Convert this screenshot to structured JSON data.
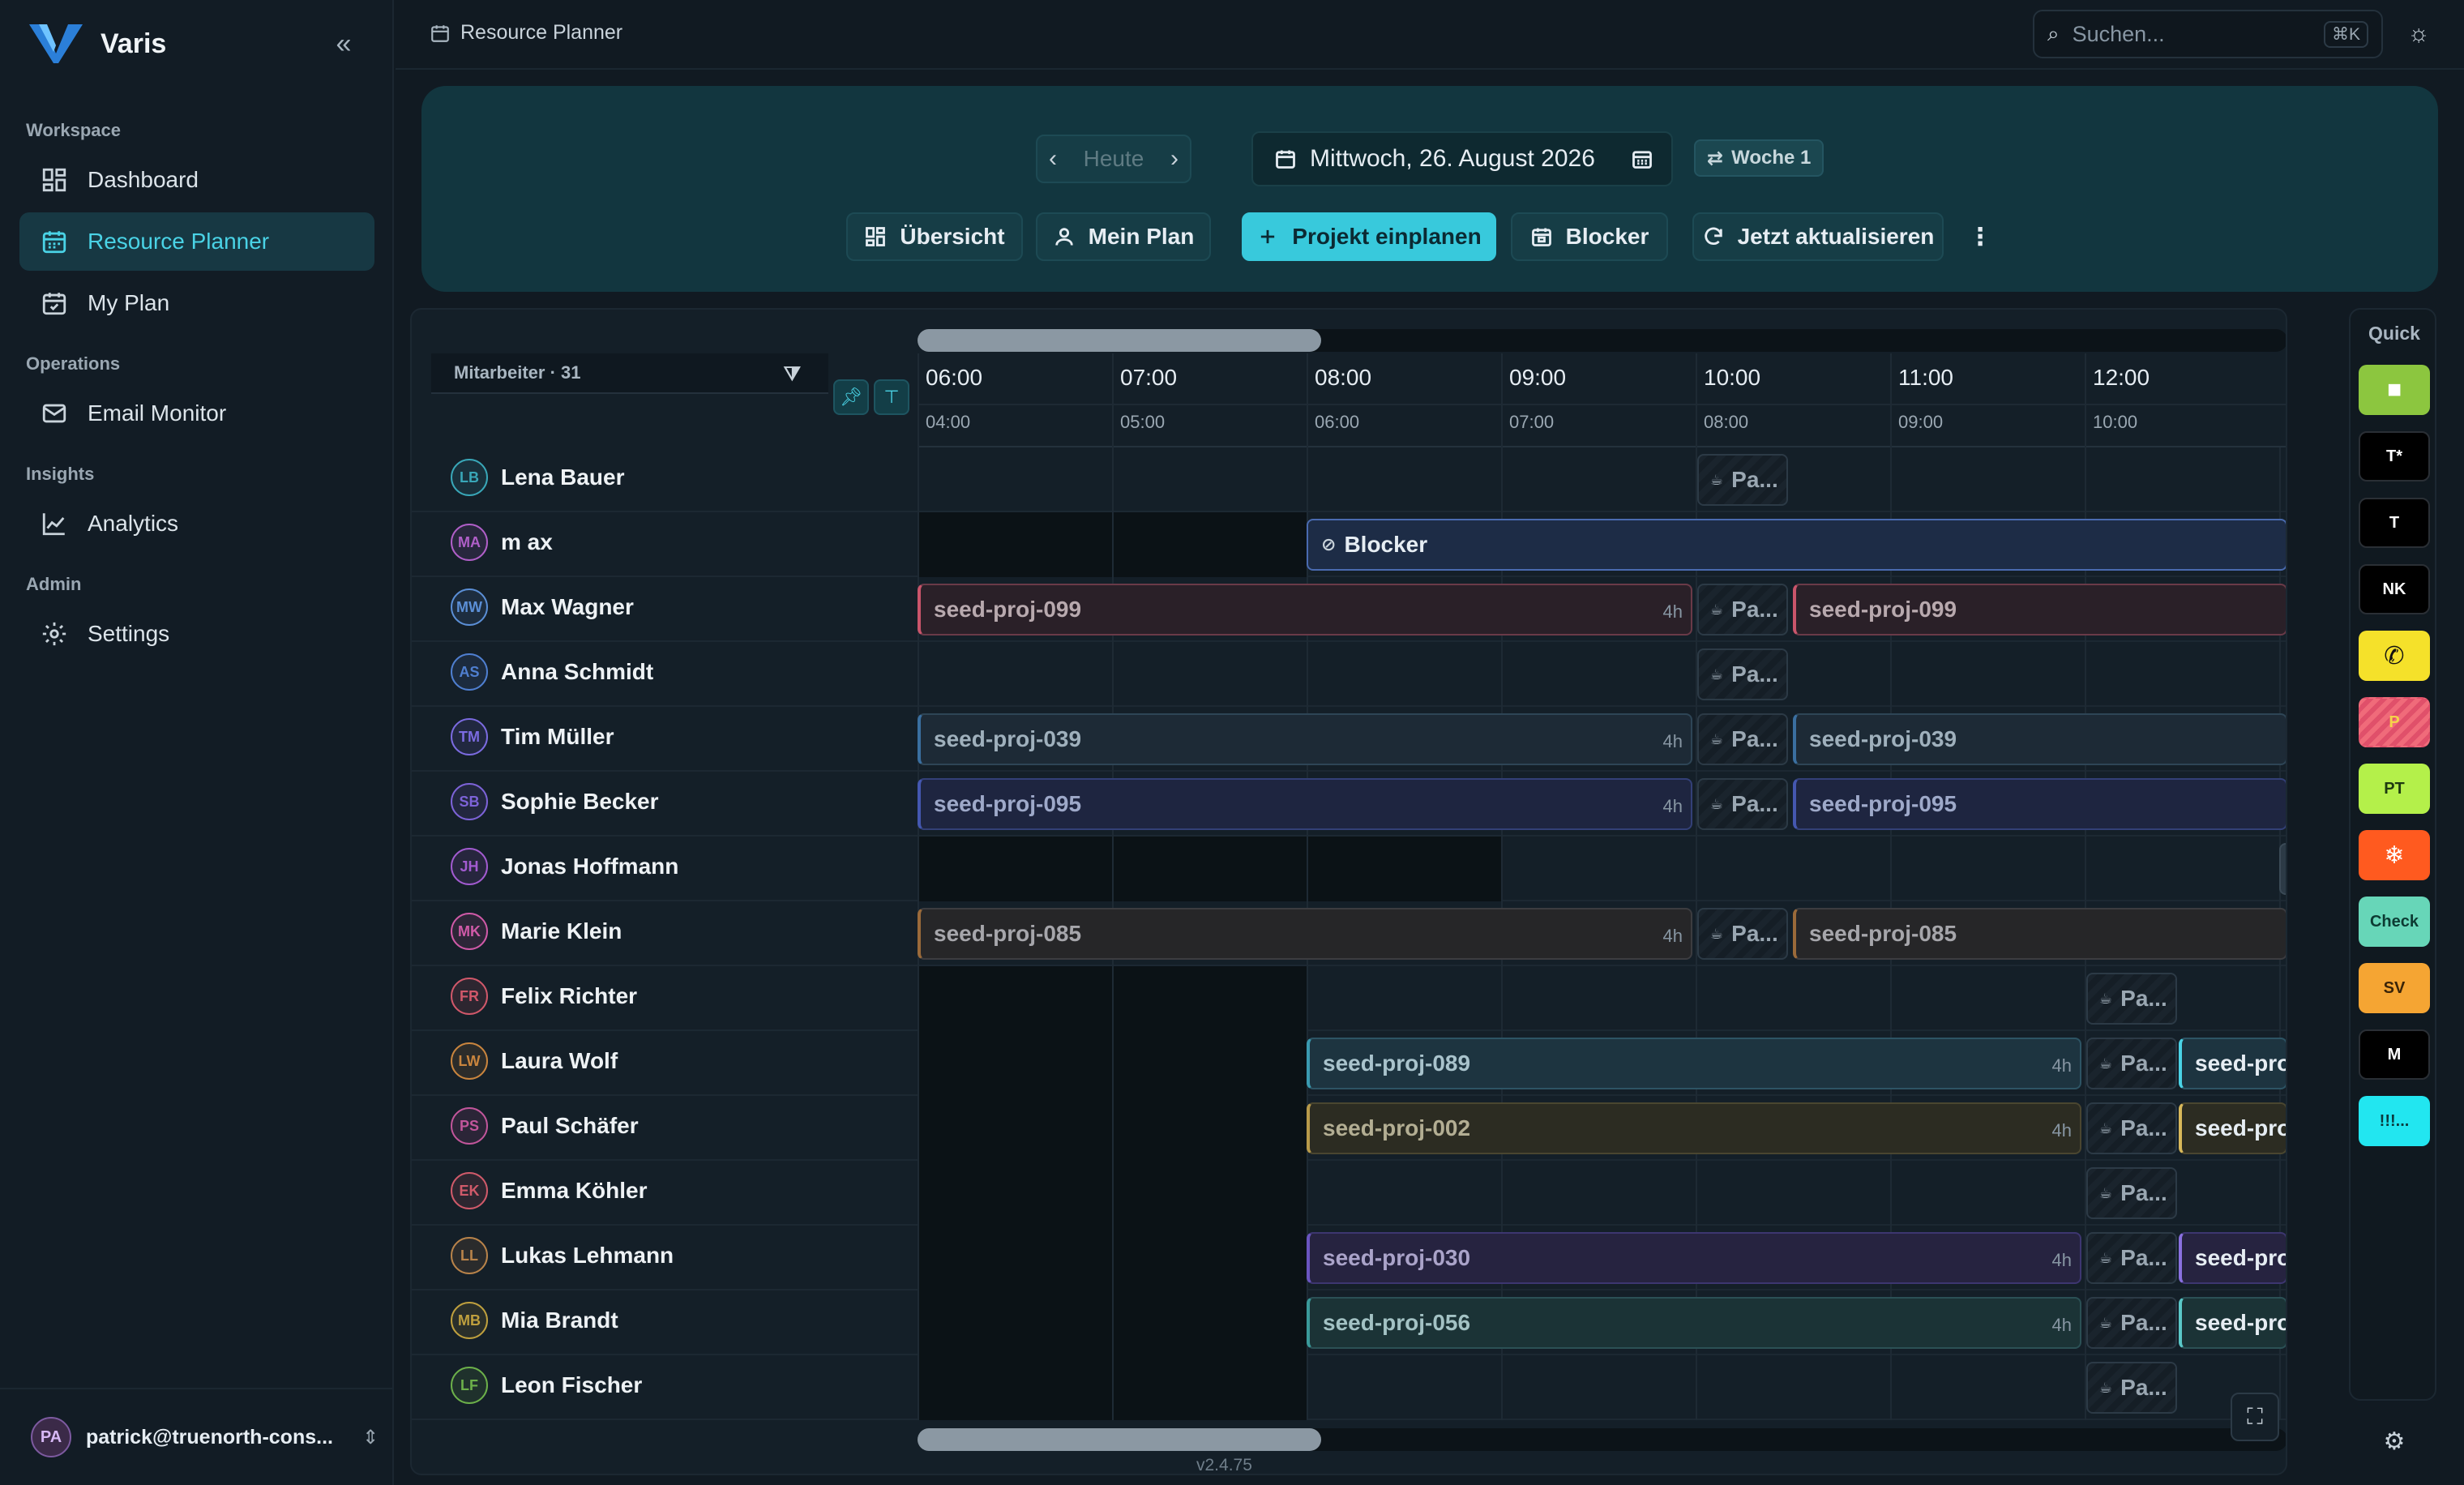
{
  "app": {
    "brand": "Varis",
    "version": "v2.4.75"
  },
  "sidebar": {
    "sections": [
      {
        "label": "Workspace",
        "items": [
          {
            "label": "Dashboard",
            "icon": "grid-icon"
          },
          {
            "label": "Resource Planner",
            "icon": "calendar-icon",
            "active": true
          },
          {
            "label": "My Plan",
            "icon": "calendar-check-icon"
          }
        ]
      },
      {
        "label": "Operations",
        "items": [
          {
            "label": "Email Monitor",
            "icon": "mail-icon"
          }
        ]
      },
      {
        "label": "Insights",
        "items": [
          {
            "label": "Analytics",
            "icon": "chart-line-icon"
          }
        ]
      },
      {
        "label": "Admin",
        "items": [
          {
            "label": "Settings",
            "icon": "gear-icon"
          }
        ]
      }
    ],
    "user": {
      "initials": "PA",
      "email": "patrick@truenorth-cons..."
    }
  },
  "topbar": {
    "breadcrumb": "Resource Planner",
    "search_placeholder": "Suchen...",
    "search_shortcut": "⌘K"
  },
  "toolbar": {
    "today": "Heute",
    "date": "Mittwoch, 26. August 2026",
    "week": "Woche 1",
    "overview": "Übersicht",
    "my_plan": "Mein Plan",
    "plan_project": "Projekt einplanen",
    "blocker": "Blocker",
    "refresh": "Jetzt aktualisieren"
  },
  "planner": {
    "employees_header": "Mitarbeiter · 31",
    "hours": [
      {
        "main": "06:00",
        "sub": "04:00"
      },
      {
        "main": "07:00",
        "sub": "05:00"
      },
      {
        "main": "08:00",
        "sub": "06:00"
      },
      {
        "main": "09:00",
        "sub": "07:00"
      },
      {
        "main": "10:00",
        "sub": "08:00"
      },
      {
        "main": "11:00",
        "sub": "09:00"
      },
      {
        "main": "12:00",
        "sub": "10:00"
      }
    ],
    "pause_label": "Pa...",
    "duration_label": "4h",
    "rows": [
      {
        "initials": "LB",
        "name": "Lena Bauer",
        "color": "#39a7b8"
      },
      {
        "initials": "MA",
        "name": "m ax",
        "color": "#b05fc8"
      },
      {
        "initials": "MW",
        "name": "Max Wagner",
        "color": "#5b8fd6"
      },
      {
        "initials": "AS",
        "name": "Anna Schmidt",
        "color": "#4f7fd0"
      },
      {
        "initials": "TM",
        "name": "Tim Müller",
        "color": "#7b6be0"
      },
      {
        "initials": "SB",
        "name": "Sophie Becker",
        "color": "#7d63d8"
      },
      {
        "initials": "JH",
        "name": "Jonas Hoffmann",
        "color": "#a25bd0"
      },
      {
        "initials": "MK",
        "name": "Marie Klein",
        "color": "#d05aa8"
      },
      {
        "initials": "FR",
        "name": "Felix Richter",
        "color": "#d0586a"
      },
      {
        "initials": "LW",
        "name": "Laura Wolf",
        "color": "#c9853e"
      },
      {
        "initials": "PS",
        "name": "Paul Schäfer",
        "color": "#c2569b"
      },
      {
        "initials": "EK",
        "name": "Emma Köhler",
        "color": "#d05a6a"
      },
      {
        "initials": "LL",
        "name": "Lukas Lehmann",
        "color": "#b8834a"
      },
      {
        "initials": "MB",
        "name": "Mia Brandt",
        "color": "#bfa03e"
      },
      {
        "initials": "LF",
        "name": "Leon Fischer",
        "color": "#6cb04a"
      }
    ],
    "bars": {
      "blocker": "Blocker",
      "p099": "seed-proj-099",
      "p039": "seed-proj-039",
      "p095": "seed-proj-095",
      "p085": "seed-proj-085",
      "p089": "seed-proj-089",
      "p002": "seed-proj-002",
      "p030": "seed-proj-030",
      "p056": "seed-proj-056",
      "trunc": "seed-pro"
    }
  },
  "quick": {
    "title": "Quick",
    "buttons": [
      {
        "label": "",
        "bg": "#8cc63f",
        "fg": "#ffffff",
        "icon": "square-icon"
      },
      {
        "label": "T*",
        "bg": "#000000",
        "fg": "#ffffff"
      },
      {
        "label": "T",
        "bg": "#000000",
        "fg": "#ffffff"
      },
      {
        "label": "NK",
        "bg": "#000000",
        "fg": "#ffffff"
      },
      {
        "label": "",
        "bg": "#f5e12a",
        "fg": "#111111",
        "icon": "phone-icon"
      },
      {
        "label": "P",
        "bg": "#f06b7a",
        "fg": "#f5d34a"
      },
      {
        "label": "PT",
        "bg": "#b4f04a",
        "fg": "#1d3a10"
      },
      {
        "label": "",
        "bg": "#ff5a1f",
        "fg": "#ffffff",
        "icon": "snowflake-icon"
      },
      {
        "label": "Check",
        "bg": "#67d6b8",
        "fg": "#0d3b33"
      },
      {
        "label": "SV",
        "bg": "#f5a533",
        "fg": "#3a2408"
      },
      {
        "label": "M",
        "bg": "#000000",
        "fg": "#ffffff"
      },
      {
        "label": "!!!...",
        "bg": "#22e6f0",
        "fg": "#0b3a3d"
      }
    ]
  }
}
